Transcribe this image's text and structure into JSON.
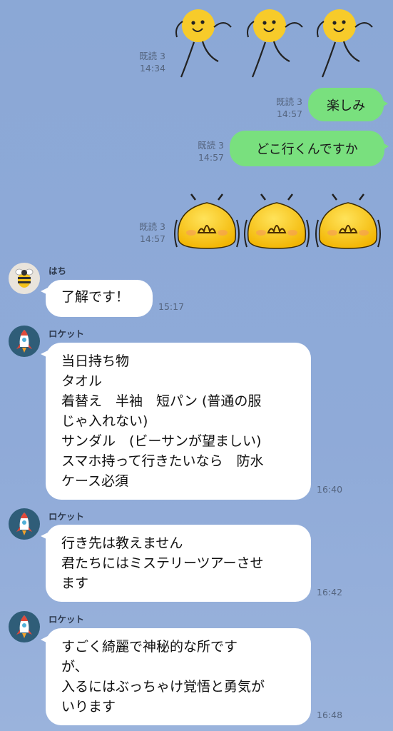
{
  "read_label": "既読 3",
  "msgs": {
    "m1": {
      "time": "14:34"
    },
    "m2": {
      "text": "楽しみ",
      "time": "14:57"
    },
    "m3": {
      "text": "どこ行くんですか",
      "time": "14:57"
    },
    "m4": {
      "time": "14:57"
    },
    "m5": {
      "sender": "はち",
      "text": "了解です！",
      "time": "15:17"
    },
    "m6": {
      "sender": "ロケット",
      "time": "16:40",
      "lines": [
        "当日持ち物",
        "タオル",
        "着替え　半袖　短パン (普通の服",
        "じゃ入れない)",
        "サンダル　(ビーサンが望ましい)",
        "スマホ持って行きたいなら　防水",
        "ケース必須"
      ]
    },
    "m7": {
      "sender": "ロケット",
      "time": "16:42",
      "lines": [
        "行き先は教えません",
        "君たちにはミステリーツアーさせ",
        "ます"
      ]
    },
    "m8": {
      "sender": "ロケット",
      "time": "16:48",
      "lines": [
        "すごく綺麗で神秘的な所です",
        "が、",
        "入るにはぶっちゃけ覚悟と勇気が",
        "いります"
      ]
    }
  },
  "colors": {
    "background": "#8faad8",
    "outgoing_bubble": "#79e07e",
    "incoming_bubble": "#ffffff"
  },
  "stickers": {
    "m1": "running-chick-sticker",
    "m4": "bee-blob-sticker"
  }
}
